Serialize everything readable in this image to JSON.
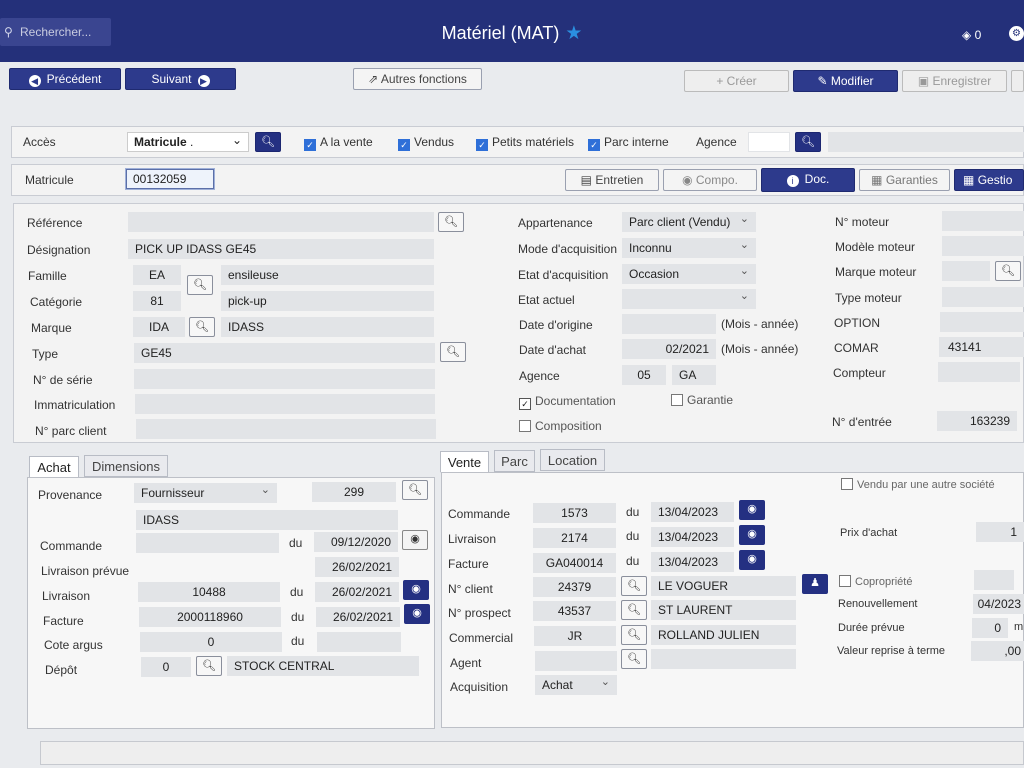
{
  "app": {
    "search_placeholder": "Rechercher...",
    "title": "Matériel (MAT)",
    "layers_count": "0"
  },
  "toolbar": {
    "prev": "Précédent",
    "next": "Suivant",
    "other": "Autres fonctions",
    "create": "Créer",
    "modify": "Modifier",
    "save": "Enregistrer"
  },
  "access": {
    "label": "Accès",
    "select": "Matricule",
    "dot": ".",
    "chk_vente": "A la vente",
    "chk_vendus": "Vendus",
    "chk_petits": "Petits matériels",
    "chk_parc": "Parc interne",
    "agence": "Agence"
  },
  "matricule": {
    "label": "Matricule",
    "value": "00132059",
    "btn_entretien": "Entretien",
    "btn_compo": "Compo.",
    "btn_doc": "Doc.",
    "btn_garanties": "Garanties",
    "btn_gestion": "Gestio"
  },
  "main": {
    "reference": "Référence",
    "designation": "Désignation",
    "designation_val": "PICK UP IDASS GE45",
    "famille": "Famille",
    "famille_code": "EA",
    "famille_name": "ensileuse",
    "categorie": "Catégorie",
    "categorie_code": "81",
    "categorie_name": "pick-up",
    "marque": "Marque",
    "marque_code": "IDA",
    "marque_name": "IDASS",
    "type": "Type",
    "type_val": "GE45",
    "serie": "N° de série",
    "immat": "Immatriculation",
    "parc_client": "N° parc client",
    "appartenance": "Appartenance",
    "appartenance_val": "Parc client (Vendu)",
    "mode_acq": "Mode d'acquisition",
    "mode_acq_val": "Inconnu",
    "etat_acq": "Etat d'acquisition",
    "etat_acq_val": "Occasion",
    "etat_actuel": "Etat actuel",
    "date_origine": "Date d'origine",
    "mois_annee": "(Mois - année)",
    "date_achat": "Date d'achat",
    "date_achat_val": "02/2021",
    "mois_annee2": "(Mois - année)",
    "agence": "Agence",
    "agence_code": "05",
    "agence_name": "GA",
    "documentation": "Documentation",
    "garantie": "Garantie",
    "composition": "Composition",
    "n_moteur": "N° moteur",
    "modele_moteur": "Modèle moteur",
    "marque_moteur": "Marque moteur",
    "type_moteur": "Type moteur",
    "option": "OPTION",
    "comar": "COMAR",
    "comar_val": "43141",
    "compteur": "Compteur",
    "n_entree": "N° d'entrée",
    "n_entree_val": "163239"
  },
  "achat": {
    "tab_achat": "Achat",
    "tab_dimensions": "Dimensions",
    "provenance": "Provenance",
    "provenance_val": "Fournisseur",
    "provenance_code": "299",
    "provenance_name": "IDASS",
    "commande": "Commande",
    "du": "du",
    "commande_date": "09/12/2020",
    "livraison_prevue": "Livraison prévue",
    "livraison_prevue_date": "26/02/2021",
    "livraison": "Livraison",
    "livraison_val": "10488",
    "livraison_date": "26/02/2021",
    "facture": "Facture",
    "facture_val": "2000118960",
    "facture_date": "26/02/2021",
    "cote_argus": "Cote argus",
    "cote_argus_val": "0",
    "depot": "Dépôt",
    "depot_val": "0",
    "depot_name": "STOCK CENTRAL"
  },
  "vente": {
    "tab_vente": "Vente",
    "tab_parc": "Parc",
    "tab_location": "Location",
    "commande": "Commande",
    "commande_val": "1573",
    "du": "du",
    "commande_date": "13/04/2023",
    "livraison": "Livraison",
    "livraison_val": "2174",
    "livraison_date": "13/04/2023",
    "facture": "Facture",
    "facture_val": "GA040014",
    "facture_date": "13/04/2023",
    "client": "N° client",
    "client_val": "24379",
    "client_name": "LE VOGUER",
    "prospect": "N° prospect",
    "prospect_val": "43537",
    "prospect_name": "ST LAURENT",
    "commercial": "Commercial",
    "commercial_val": "JR",
    "commercial_name": "ROLLAND JULIEN",
    "agent": "Agent",
    "acquisition": "Acquisition",
    "acquisition_val": "Achat"
  },
  "right": {
    "vendu_societe": "Vendu par une autre société",
    "prix_achat": "Prix d'achat",
    "prix_achat_val": "1",
    "copropriete": "Copropriété",
    "renouvellement": "Renouvellement",
    "renouvellement_val": "04/2023",
    "duree": "Durée prévue",
    "duree_val": "0",
    "duree_unit": "m",
    "valeur_reprise": "Valeur reprise à terme",
    "valeur_reprise_val": ",00"
  }
}
